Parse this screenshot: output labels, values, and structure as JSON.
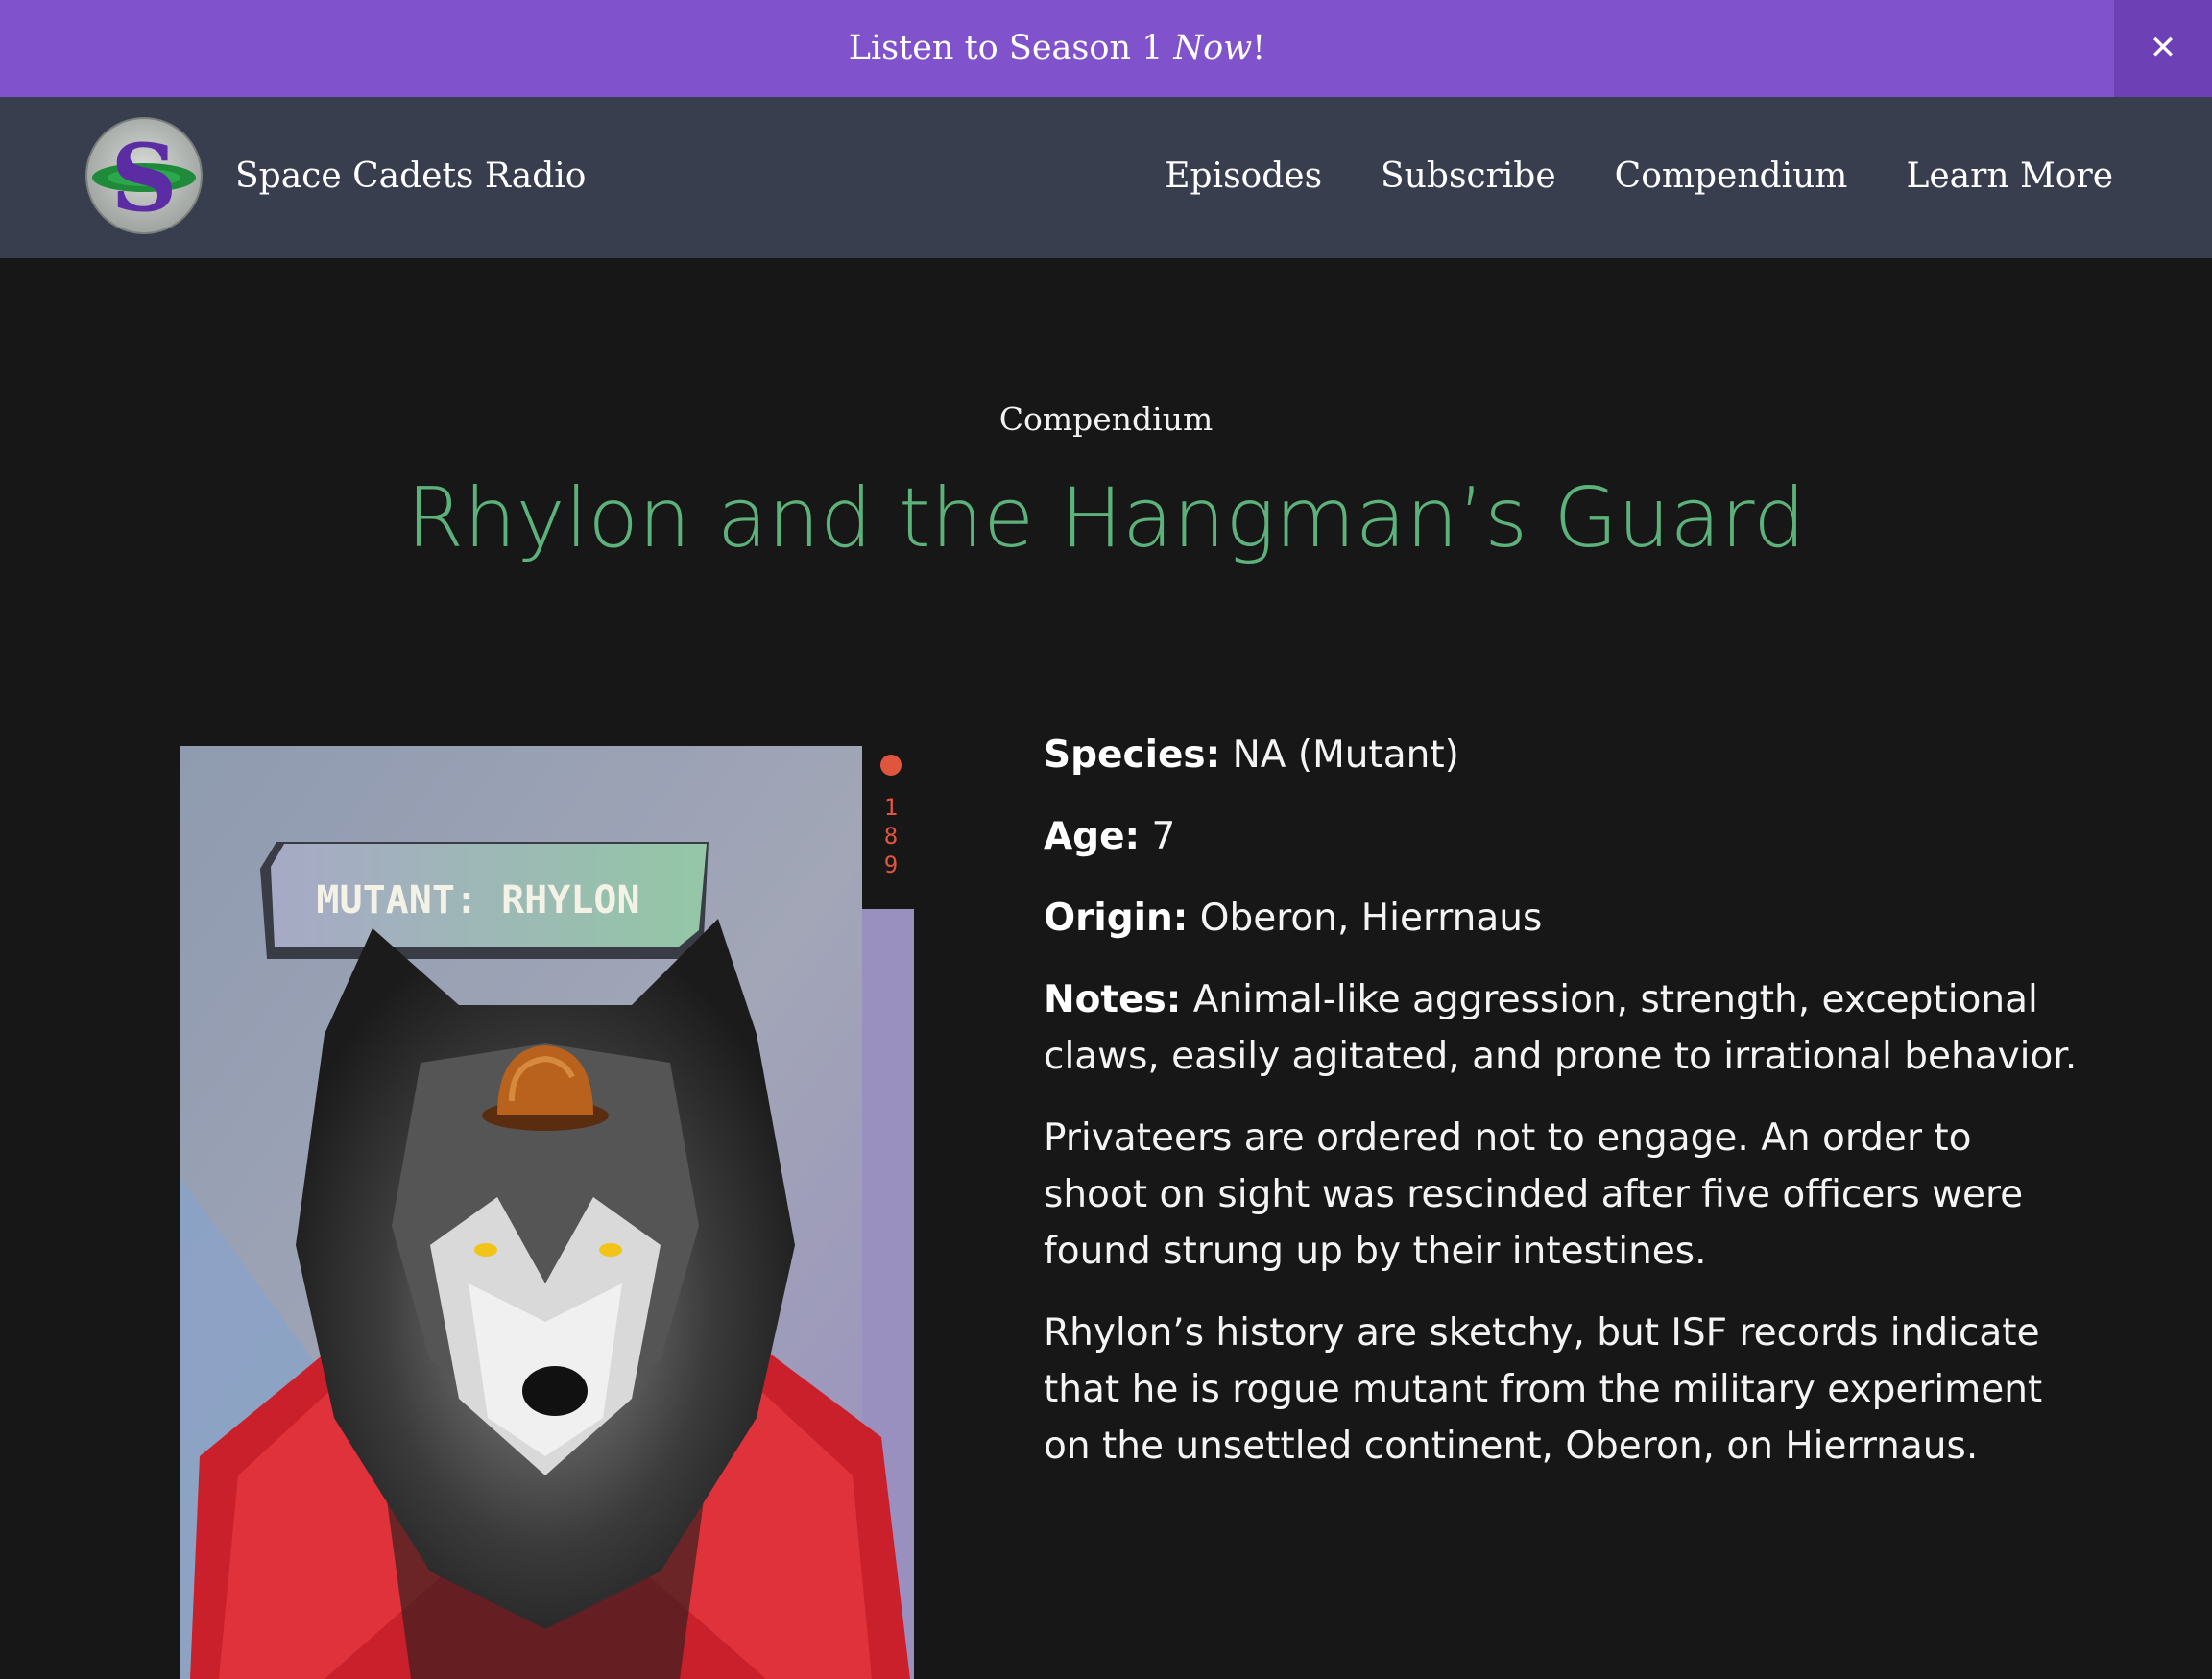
{
  "banner": {
    "text_prefix": "Listen to Season 1 ",
    "text_emphasis": "Now",
    "text_suffix": "!",
    "close_label": "✕"
  },
  "header": {
    "logo_letter": "S",
    "site_title": "Space Cadets Radio",
    "nav": [
      "Episodes",
      "Subscribe",
      "Compendium",
      "Learn More"
    ]
  },
  "page": {
    "eyebrow": "Compendium",
    "title": "Rhylon and the Hangman’s Guard"
  },
  "card": {
    "label": "MUTANT: RHYLON",
    "serial": [
      "1",
      "8",
      "9"
    ]
  },
  "details": {
    "species_label": "Species:",
    "species_value": " NA (Mutant)",
    "age_label": "Age:",
    "age_value": " 7",
    "origin_label": "Origin:",
    "origin_value": " Oberon, Hierrnaus",
    "notes_label": "Notes:",
    "notes_value": " Animal-like aggression, strength, exceptional claws, easily agitated, and prone to irrational behavior.",
    "paragraph_2": "Privateers are ordered not to engage. An order to shoot on sight was rescinded after five officers were found strung up by their intestines.",
    "paragraph_3": "Rhylon’s history are sketchy, but ISF records indicate that he is rogue mutant from the military experiment on the unsettled continent, Oberon, on Hierrnaus."
  },
  "colors": {
    "banner": "#8052cb",
    "banner_close": "#6d41b5",
    "header": "#393e4f",
    "background": "#171717",
    "title": "#5cb27a"
  }
}
